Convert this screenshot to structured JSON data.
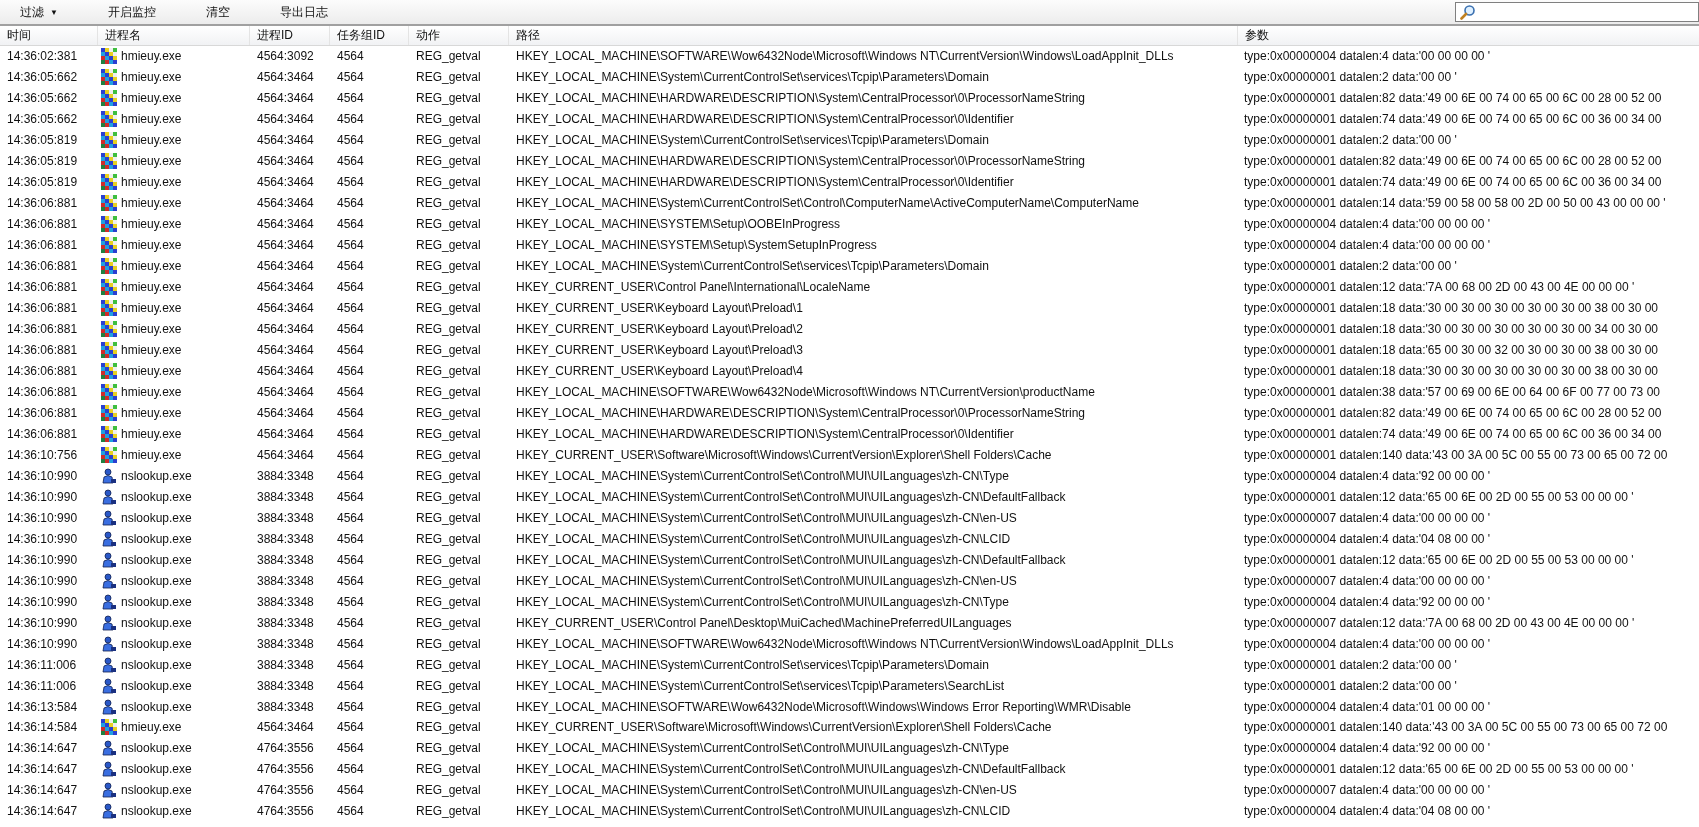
{
  "toolbar": {
    "buttons": [
      {
        "label": "过滤",
        "kind": "dropdown",
        "caret": "▼"
      },
      {
        "label": "开启监控",
        "kind": "plain"
      },
      {
        "label": "清空",
        "kind": "plain"
      },
      {
        "label": "导出日志",
        "kind": "plain"
      }
    ]
  },
  "table": {
    "columns": [
      "时间",
      "进程名",
      "进程ID",
      "任务组ID",
      "动作",
      "路径",
      "参数"
    ],
    "rows": [
      {
        "time": "14:36:02:381",
        "kind": "mosaic",
        "process": "hmieuy.exe",
        "pid": "4564:3092",
        "group": "4564",
        "action": "REG_getval",
        "path": "HKEY_LOCAL_MACHINE\\SOFTWARE\\Wow6432Node\\Microsoft\\Windows NT\\CurrentVersion\\Windows\\LoadAppInit_DLLs",
        "params": "type:0x00000004 datalen:4 data:'00 00 00 00 '"
      },
      {
        "time": "14:36:05:662",
        "kind": "mosaic",
        "process": "hmieuy.exe",
        "pid": "4564:3464",
        "group": "4564",
        "action": "REG_getval",
        "path": "HKEY_LOCAL_MACHINE\\System\\CurrentControlSet\\services\\Tcpip\\Parameters\\Domain",
        "params": "type:0x00000001 datalen:2 data:'00 00 '"
      },
      {
        "time": "14:36:05:662",
        "kind": "mosaic",
        "process": "hmieuy.exe",
        "pid": "4564:3464",
        "group": "4564",
        "action": "REG_getval",
        "path": "HKEY_LOCAL_MACHINE\\HARDWARE\\DESCRIPTION\\System\\CentralProcessor\\0\\ProcessorNameString",
        "params": "type:0x00000001 datalen:82 data:'49 00 6E 00 74 00 65 00 6C 00 28 00 52 00"
      },
      {
        "time": "14:36:05:662",
        "kind": "mosaic",
        "process": "hmieuy.exe",
        "pid": "4564:3464",
        "group": "4564",
        "action": "REG_getval",
        "path": "HKEY_LOCAL_MACHINE\\HARDWARE\\DESCRIPTION\\System\\CentralProcessor\\0\\Identifier",
        "params": "type:0x00000001 datalen:74 data:'49 00 6E 00 74 00 65 00 6C 00 36 00 34 00"
      },
      {
        "time": "14:36:05:819",
        "kind": "mosaic",
        "process": "hmieuy.exe",
        "pid": "4564:3464",
        "group": "4564",
        "action": "REG_getval",
        "path": "HKEY_LOCAL_MACHINE\\System\\CurrentControlSet\\services\\Tcpip\\Parameters\\Domain",
        "params": "type:0x00000001 datalen:2 data:'00 00 '"
      },
      {
        "time": "14:36:05:819",
        "kind": "mosaic",
        "process": "hmieuy.exe",
        "pid": "4564:3464",
        "group": "4564",
        "action": "REG_getval",
        "path": "HKEY_LOCAL_MACHINE\\HARDWARE\\DESCRIPTION\\System\\CentralProcessor\\0\\ProcessorNameString",
        "params": "type:0x00000001 datalen:82 data:'49 00 6E 00 74 00 65 00 6C 00 28 00 52 00"
      },
      {
        "time": "14:36:05:819",
        "kind": "mosaic",
        "process": "hmieuy.exe",
        "pid": "4564:3464",
        "group": "4564",
        "action": "REG_getval",
        "path": "HKEY_LOCAL_MACHINE\\HARDWARE\\DESCRIPTION\\System\\CentralProcessor\\0\\Identifier",
        "params": "type:0x00000001 datalen:74 data:'49 00 6E 00 74 00 65 00 6C 00 36 00 34 00"
      },
      {
        "time": "14:36:06:881",
        "kind": "mosaic",
        "process": "hmieuy.exe",
        "pid": "4564:3464",
        "group": "4564",
        "action": "REG_getval",
        "path": "HKEY_LOCAL_MACHINE\\System\\CurrentControlSet\\Control\\ComputerName\\ActiveComputerName\\ComputerName",
        "params": "type:0x00000001 datalen:14 data:'59 00 58 00 58 00 2D 00 50 00 43 00 00 00 '"
      },
      {
        "time": "14:36:06:881",
        "kind": "mosaic",
        "process": "hmieuy.exe",
        "pid": "4564:3464",
        "group": "4564",
        "action": "REG_getval",
        "path": "HKEY_LOCAL_MACHINE\\SYSTEM\\Setup\\OOBEInProgress",
        "params": "type:0x00000004 datalen:4 data:'00 00 00 00 '"
      },
      {
        "time": "14:36:06:881",
        "kind": "mosaic",
        "process": "hmieuy.exe",
        "pid": "4564:3464",
        "group": "4564",
        "action": "REG_getval",
        "path": "HKEY_LOCAL_MACHINE\\SYSTEM\\Setup\\SystemSetupInProgress",
        "params": "type:0x00000004 datalen:4 data:'00 00 00 00 '"
      },
      {
        "time": "14:36:06:881",
        "kind": "mosaic",
        "process": "hmieuy.exe",
        "pid": "4564:3464",
        "group": "4564",
        "action": "REG_getval",
        "path": "HKEY_LOCAL_MACHINE\\System\\CurrentControlSet\\services\\Tcpip\\Parameters\\Domain",
        "params": "type:0x00000001 datalen:2 data:'00 00 '"
      },
      {
        "time": "14:36:06:881",
        "kind": "mosaic",
        "process": "hmieuy.exe",
        "pid": "4564:3464",
        "group": "4564",
        "action": "REG_getval",
        "path": "HKEY_CURRENT_USER\\Control Panel\\International\\LocaleName",
        "params": "type:0x00000001 datalen:12 data:'7A 00 68 00 2D 00 43 00 4E 00 00 00 '"
      },
      {
        "time": "14:36:06:881",
        "kind": "mosaic",
        "process": "hmieuy.exe",
        "pid": "4564:3464",
        "group": "4564",
        "action": "REG_getval",
        "path": "HKEY_CURRENT_USER\\Keyboard Layout\\Preload\\1",
        "params": "type:0x00000001 datalen:18 data:'30 00 30 00 30 00 30 00 30 00 38 00 30 00"
      },
      {
        "time": "14:36:06:881",
        "kind": "mosaic",
        "process": "hmieuy.exe",
        "pid": "4564:3464",
        "group": "4564",
        "action": "REG_getval",
        "path": "HKEY_CURRENT_USER\\Keyboard Layout\\Preload\\2",
        "params": "type:0x00000001 datalen:18 data:'30 00 30 00 30 00 30 00 30 00 34 00 30 00"
      },
      {
        "time": "14:36:06:881",
        "kind": "mosaic",
        "process": "hmieuy.exe",
        "pid": "4564:3464",
        "group": "4564",
        "action": "REG_getval",
        "path": "HKEY_CURRENT_USER\\Keyboard Layout\\Preload\\3",
        "params": "type:0x00000001 datalen:18 data:'65 00 30 00 32 00 30 00 30 00 38 00 30 00"
      },
      {
        "time": "14:36:06:881",
        "kind": "mosaic",
        "process": "hmieuy.exe",
        "pid": "4564:3464",
        "group": "4564",
        "action": "REG_getval",
        "path": "HKEY_CURRENT_USER\\Keyboard Layout\\Preload\\4",
        "params": "type:0x00000001 datalen:18 data:'30 00 30 00 30 00 30 00 30 00 38 00 30 00"
      },
      {
        "time": "14:36:06:881",
        "kind": "mosaic",
        "process": "hmieuy.exe",
        "pid": "4564:3464",
        "group": "4564",
        "action": "REG_getval",
        "path": "HKEY_LOCAL_MACHINE\\SOFTWARE\\Wow6432Node\\Microsoft\\Windows NT\\CurrentVersion\\productName",
        "params": "type:0x00000001 datalen:38 data:'57 00 69 00 6E 00 64 00 6F 00 77 00 73 00"
      },
      {
        "time": "14:36:06:881",
        "kind": "mosaic",
        "process": "hmieuy.exe",
        "pid": "4564:3464",
        "group": "4564",
        "action": "REG_getval",
        "path": "HKEY_LOCAL_MACHINE\\HARDWARE\\DESCRIPTION\\System\\CentralProcessor\\0\\ProcessorNameString",
        "params": "type:0x00000001 datalen:82 data:'49 00 6E 00 74 00 65 00 6C 00 28 00 52 00"
      },
      {
        "time": "14:36:06:881",
        "kind": "mosaic",
        "process": "hmieuy.exe",
        "pid": "4564:3464",
        "group": "4564",
        "action": "REG_getval",
        "path": "HKEY_LOCAL_MACHINE\\HARDWARE\\DESCRIPTION\\System\\CentralProcessor\\0\\Identifier",
        "params": "type:0x00000001 datalen:74 data:'49 00 6E 00 74 00 65 00 6C 00 36 00 34 00"
      },
      {
        "time": "14:36:10:756",
        "kind": "mosaic",
        "process": "hmieuy.exe",
        "pid": "4564:3464",
        "group": "4564",
        "action": "REG_getval",
        "path": "HKEY_CURRENT_USER\\Software\\Microsoft\\Windows\\CurrentVersion\\Explorer\\Shell Folders\\Cache",
        "params": "type:0x00000001 datalen:140 data:'43 00 3A 00 5C 00 55 00 73 00 65 00 72 00"
      },
      {
        "time": "14:36:10:990",
        "kind": "person",
        "process": "nslookup.exe",
        "pid": "3884:3348",
        "group": "4564",
        "action": "REG_getval",
        "path": "HKEY_LOCAL_MACHINE\\System\\CurrentControlSet\\Control\\MUI\\UILanguages\\zh-CN\\Type",
        "params": "type:0x00000004 datalen:4 data:'92 00 00 00 '"
      },
      {
        "time": "14:36:10:990",
        "kind": "person",
        "process": "nslookup.exe",
        "pid": "3884:3348",
        "group": "4564",
        "action": "REG_getval",
        "path": "HKEY_LOCAL_MACHINE\\System\\CurrentControlSet\\Control\\MUI\\UILanguages\\zh-CN\\DefaultFallback",
        "params": "type:0x00000001 datalen:12 data:'65 00 6E 00 2D 00 55 00 53 00 00 00 '"
      },
      {
        "time": "14:36:10:990",
        "kind": "person",
        "process": "nslookup.exe",
        "pid": "3884:3348",
        "group": "4564",
        "action": "REG_getval",
        "path": "HKEY_LOCAL_MACHINE\\System\\CurrentControlSet\\Control\\MUI\\UILanguages\\zh-CN\\en-US",
        "params": "type:0x00000007 datalen:4 data:'00 00 00 00 '"
      },
      {
        "time": "14:36:10:990",
        "kind": "person",
        "process": "nslookup.exe",
        "pid": "3884:3348",
        "group": "4564",
        "action": "REG_getval",
        "path": "HKEY_LOCAL_MACHINE\\System\\CurrentControlSet\\Control\\MUI\\UILanguages\\zh-CN\\LCID",
        "params": "type:0x00000004 datalen:4 data:'04 08 00 00 '"
      },
      {
        "time": "14:36:10:990",
        "kind": "person",
        "process": "nslookup.exe",
        "pid": "3884:3348",
        "group": "4564",
        "action": "REG_getval",
        "path": "HKEY_LOCAL_MACHINE\\System\\CurrentControlSet\\Control\\MUI\\UILanguages\\zh-CN\\DefaultFallback",
        "params": "type:0x00000001 datalen:12 data:'65 00 6E 00 2D 00 55 00 53 00 00 00 '"
      },
      {
        "time": "14:36:10:990",
        "kind": "person",
        "process": "nslookup.exe",
        "pid": "3884:3348",
        "group": "4564",
        "action": "REG_getval",
        "path": "HKEY_LOCAL_MACHINE\\System\\CurrentControlSet\\Control\\MUI\\UILanguages\\zh-CN\\en-US",
        "params": "type:0x00000007 datalen:4 data:'00 00 00 00 '"
      },
      {
        "time": "14:36:10:990",
        "kind": "person",
        "process": "nslookup.exe",
        "pid": "3884:3348",
        "group": "4564",
        "action": "REG_getval",
        "path": "HKEY_LOCAL_MACHINE\\System\\CurrentControlSet\\Control\\MUI\\UILanguages\\zh-CN\\Type",
        "params": "type:0x00000004 datalen:4 data:'92 00 00 00 '"
      },
      {
        "time": "14:36:10:990",
        "kind": "person",
        "process": "nslookup.exe",
        "pid": "3884:3348",
        "group": "4564",
        "action": "REG_getval",
        "path": "HKEY_CURRENT_USER\\Control Panel\\Desktop\\MuiCached\\MachinePreferredUILanguages",
        "params": "type:0x00000007 datalen:12 data:'7A 00 68 00 2D 00 43 00 4E 00 00 00 '"
      },
      {
        "time": "14:36:10:990",
        "kind": "person",
        "process": "nslookup.exe",
        "pid": "3884:3348",
        "group": "4564",
        "action": "REG_getval",
        "path": "HKEY_LOCAL_MACHINE\\SOFTWARE\\Wow6432Node\\Microsoft\\Windows NT\\CurrentVersion\\Windows\\LoadAppInit_DLLs",
        "params": "type:0x00000004 datalen:4 data:'00 00 00 00 '"
      },
      {
        "time": "14:36:11:006",
        "kind": "person",
        "process": "nslookup.exe",
        "pid": "3884:3348",
        "group": "4564",
        "action": "REG_getval",
        "path": "HKEY_LOCAL_MACHINE\\System\\CurrentControlSet\\services\\Tcpip\\Parameters\\Domain",
        "params": "type:0x00000001 datalen:2 data:'00 00 '"
      },
      {
        "time": "14:36:11:006",
        "kind": "person",
        "process": "nslookup.exe",
        "pid": "3884:3348",
        "group": "4564",
        "action": "REG_getval",
        "path": "HKEY_LOCAL_MACHINE\\System\\CurrentControlSet\\services\\Tcpip\\Parameters\\SearchList",
        "params": "type:0x00000001 datalen:2 data:'00 00 '"
      },
      {
        "time": "14:36:13:584",
        "kind": "person",
        "process": "nslookup.exe",
        "pid": "3884:3348",
        "group": "4564",
        "action": "REG_getval",
        "path": "HKEY_LOCAL_MACHINE\\SOFTWARE\\Wow6432Node\\Microsoft\\Windows\\Windows Error Reporting\\WMR\\Disable",
        "params": "type:0x00000004 datalen:4 data:'01 00 00 00 '"
      },
      {
        "time": "14:36:14:584",
        "kind": "mosaic",
        "process": "hmieuy.exe",
        "pid": "4564:3464",
        "group": "4564",
        "action": "REG_getval",
        "path": "HKEY_CURRENT_USER\\Software\\Microsoft\\Windows\\CurrentVersion\\Explorer\\Shell Folders\\Cache",
        "params": "type:0x00000001 datalen:140 data:'43 00 3A 00 5C 00 55 00 73 00 65 00 72 00"
      },
      {
        "time": "14:36:14:647",
        "kind": "person",
        "process": "nslookup.exe",
        "pid": "4764:3556",
        "group": "4564",
        "action": "REG_getval",
        "path": "HKEY_LOCAL_MACHINE\\System\\CurrentControlSet\\Control\\MUI\\UILanguages\\zh-CN\\Type",
        "params": "type:0x00000004 datalen:4 data:'92 00 00 00 '"
      },
      {
        "time": "14:36:14:647",
        "kind": "person",
        "process": "nslookup.exe",
        "pid": "4764:3556",
        "group": "4564",
        "action": "REG_getval",
        "path": "HKEY_LOCAL_MACHINE\\System\\CurrentControlSet\\Control\\MUI\\UILanguages\\zh-CN\\DefaultFallback",
        "params": "type:0x00000001 datalen:12 data:'65 00 6E 00 2D 00 55 00 53 00 00 00 '"
      },
      {
        "time": "14:36:14:647",
        "kind": "person",
        "process": "nslookup.exe",
        "pid": "4764:3556",
        "group": "4564",
        "action": "REG_getval",
        "path": "HKEY_LOCAL_MACHINE\\System\\CurrentControlSet\\Control\\MUI\\UILanguages\\zh-CN\\en-US",
        "params": "type:0x00000007 datalen:4 data:'00 00 00 00 '"
      },
      {
        "time": "14:36:14:647",
        "kind": "person",
        "process": "nslookup.exe",
        "pid": "4764:3556",
        "group": "4564",
        "action": "REG_getval",
        "path": "HKEY_LOCAL_MACHINE\\System\\CurrentControlSet\\Control\\MUI\\UILanguages\\zh-CN\\LCID",
        "params": "type:0x00000004 datalen:4 data:'04 08 00 00 '"
      }
    ]
  }
}
